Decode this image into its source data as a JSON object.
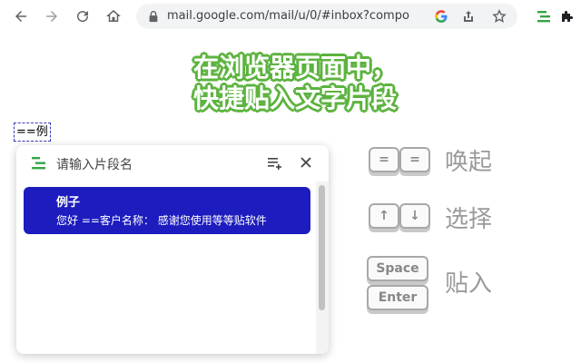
{
  "browser": {
    "url": "mail.google.com/mail/u/0/#inbox?compo",
    "back": "back-arrow",
    "forward": "forward-arrow",
    "reload": "reload",
    "home": "home"
  },
  "banner": {
    "line1": "在浏览器页面中，",
    "line2": "快捷贴入文字片段"
  },
  "editor": {
    "trigger_text": "==例"
  },
  "popup": {
    "placeholder": "请输入片段名",
    "results": [
      {
        "title": "例子",
        "content": "您好 ==客户名称：  感谢您使用等等贴软件"
      }
    ]
  },
  "legend": {
    "invoke": {
      "label": "唤起",
      "keys": [
        "=",
        "="
      ]
    },
    "select": {
      "label": "选择",
      "keys": [
        "↑",
        "↓"
      ]
    },
    "paste": {
      "label": "贴入",
      "keys": [
        "Space",
        "Enter"
      ]
    }
  },
  "colors": {
    "accent_green": "#5cb33f",
    "selection_blue": "#1c1cbf"
  }
}
